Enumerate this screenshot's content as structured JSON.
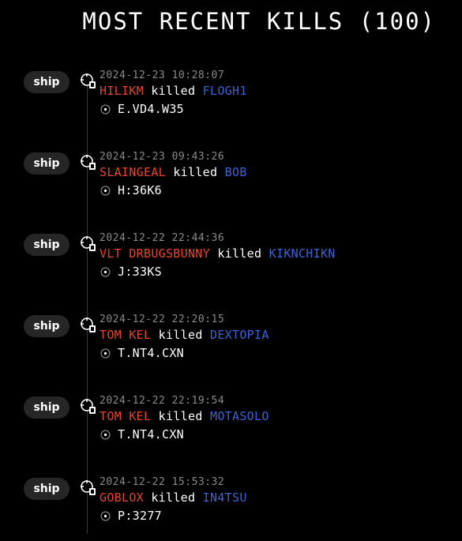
{
  "header": {
    "title": "MOST RECENT KILLS (100)"
  },
  "kills": [
    {
      "badge": "ship",
      "timestamp": "2024-12-23 10:28:07",
      "killer": "HILIKM",
      "verb": "killed",
      "victim": "FLOGH1",
      "location": "E.VD4.W35"
    },
    {
      "badge": "ship",
      "timestamp": "2024-12-23 09:43:26",
      "killer": "SLAINGEAL",
      "verb": "killed",
      "victim": "BOB",
      "location": "H:36K6"
    },
    {
      "badge": "ship",
      "timestamp": "2024-12-22 22:44:36",
      "killer": "VLT DRBUGSBUNNY",
      "verb": "killed",
      "victim": "KIKNCHIKN",
      "location": "J:33KS"
    },
    {
      "badge": "ship",
      "timestamp": "2024-12-22 22:20:15",
      "killer": "TOM KEL",
      "verb": "killed",
      "victim": "DEXTOPIA",
      "location": "T.NT4.CXN"
    },
    {
      "badge": "ship",
      "timestamp": "2024-12-22 22:19:54",
      "killer": "TOM KEL",
      "verb": "killed",
      "victim": "MOTASOLO",
      "location": "T.NT4.CXN"
    },
    {
      "badge": "ship",
      "timestamp": "2024-12-22 15:53:32",
      "killer": "GOBLOX",
      "verb": "killed",
      "victim": "IN4TSU",
      "location": "P:3277"
    }
  ],
  "icons": {
    "event": "crosshair-icon",
    "location": "target-icon"
  },
  "colors": {
    "background": "#000000",
    "killer": "#e8442e",
    "victim": "#3d63d6",
    "timestamp": "#8a8a8a",
    "badge_bg": "#262626"
  }
}
